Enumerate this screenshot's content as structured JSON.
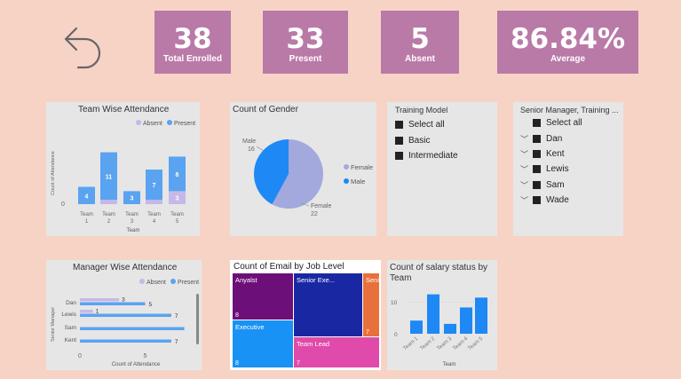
{
  "back_button": {
    "icon": "back-arrow-icon"
  },
  "kpis": [
    {
      "value": "38",
      "label": "Total Enrolled"
    },
    {
      "value": "33",
      "label": "Present"
    },
    {
      "value": "5",
      "label": "Absent"
    },
    {
      "value": "86.84%",
      "label": "Average"
    }
  ],
  "team_attendance": {
    "title": "Team Wise Attendance",
    "legend_absent": "Absent",
    "legend_present": "Present",
    "ylabel": "Count of Attendance",
    "xlabel": "Team",
    "y0": "0",
    "colors": {
      "absent": "#c7b8e8",
      "present": "#5aa3f0"
    }
  },
  "gender": {
    "title": "Count of Gender",
    "male_label": "Male",
    "male_value": "16",
    "female_label": "Female",
    "female_value": "22",
    "legend_female": "Female",
    "legend_male": "Male",
    "colors": {
      "female": "#a3a8dd",
      "male": "#1e88f5"
    }
  },
  "training_model": {
    "title": "Training Model",
    "items": [
      "Select all",
      "Basic",
      "Intermediate"
    ]
  },
  "senior_manager": {
    "title": "Senior Manager, Training ...",
    "items": [
      "Select all",
      "Dan",
      "Kent",
      "Lewis",
      "Sam",
      "Wade"
    ]
  },
  "manager_attendance": {
    "title": "Manager Wise Attendance",
    "legend_absent": "Absent",
    "legend_present": "Present",
    "ylabel": "Senior Manager",
    "xlabel": "Count of Attendance",
    "x0": "0",
    "x5": "5"
  },
  "job_level": {
    "title": "Count of Email by Job Level",
    "tiles": [
      {
        "name": "Anyalst",
        "value": "8",
        "color": "#6c0f78"
      },
      {
        "name": "Senior Exe...",
        "value": "",
        "color": "#1a27a3"
      },
      {
        "name": "Senior A...",
        "value": "7",
        "color": "#e8703a"
      },
      {
        "name": "Executive",
        "value": "8",
        "color": "#1992f5"
      },
      {
        "name": "Team Lead",
        "value": "7",
        "color": "#e04aaa"
      }
    ]
  },
  "salary_status": {
    "title": "Count of salary status by Team",
    "xlabel": "Team",
    "ytick_10": "10",
    "ytick_0": "0",
    "color": "#1e88f5"
  },
  "chart_data": [
    {
      "type": "bar",
      "title": "Team Wise Attendance",
      "xlabel": "Team",
      "ylabel": "Count of Attendance",
      "categories": [
        "Team 1",
        "Team 2",
        "Team 3",
        "Team 4",
        "Team 5"
      ],
      "series": [
        {
          "name": "Present",
          "values": [
            4,
            11,
            3,
            7,
            8
          ]
        },
        {
          "name": "Absent",
          "values": [
            0,
            1,
            0,
            1,
            3
          ]
        }
      ],
      "data_labels_present": [
        "4",
        "11",
        "3",
        "7",
        "8"
      ],
      "data_labels_absent": [
        "",
        "",
        "",
        "",
        "3"
      ],
      "ylim": [
        0,
        13
      ]
    },
    {
      "type": "pie",
      "title": "Count of Gender",
      "categories": [
        "Female",
        "Male"
      ],
      "values": [
        22,
        16
      ]
    },
    {
      "type": "bar",
      "title": "Manager Wise Attendance",
      "xlabel": "Count of Attendance",
      "ylabel": "Senior Manager",
      "categories": [
        "Dan",
        "Lewis",
        "Sam",
        "Kent"
      ],
      "series": [
        {
          "name": "Absent",
          "values": [
            3,
            1,
            0,
            0
          ]
        },
        {
          "name": "Present",
          "values": [
            5,
            7,
            8,
            7
          ]
        }
      ],
      "data_labels_absent": [
        "3",
        "1",
        "",
        ""
      ],
      "data_labels_present": [
        "5",
        "7",
        "",
        "7"
      ],
      "xlim": [
        0,
        9
      ]
    },
    {
      "type": "bar",
      "title": "Count of salary status by Team",
      "xlabel": "Team",
      "categories": [
        "Team 1",
        "Team 2",
        "Team 3",
        "Team 4",
        "Team 5"
      ],
      "values": [
        4,
        12,
        3,
        8,
        11
      ],
      "ylim": [
        0,
        13
      ]
    }
  ]
}
